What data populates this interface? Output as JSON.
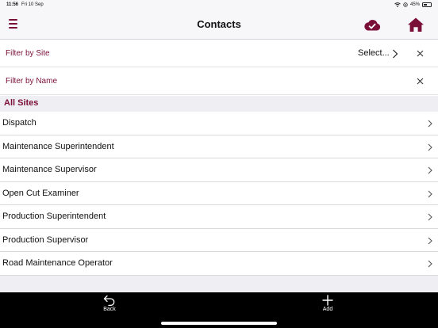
{
  "status_bar": {
    "time": "11:56",
    "date": "Fri 10 Sep",
    "battery_text": "45%",
    "battery_level_percent": 45
  },
  "nav": {
    "title": "Contacts",
    "menu_icon": "hamburger-menu-icon",
    "sync_icon": "cloud-check-icon",
    "home_icon": "home-icon",
    "accent_color": "#7a0f37"
  },
  "filters": {
    "site_label": "Filter by Site",
    "site_value": "Select...",
    "name_label": "Filter by Name"
  },
  "section": {
    "title": "All Sites"
  },
  "contacts": [
    {
      "label": "Dispatch"
    },
    {
      "label": "Maintenance Superintendent"
    },
    {
      "label": "Maintenance Supervisor"
    },
    {
      "label": "Open Cut Examiner"
    },
    {
      "label": "Production Superintendent"
    },
    {
      "label": "Production Supervisor"
    },
    {
      "label": "Road Maintenance Operator"
    }
  ],
  "tab_bar": {
    "back_label": "Back",
    "add_label": "Add"
  }
}
